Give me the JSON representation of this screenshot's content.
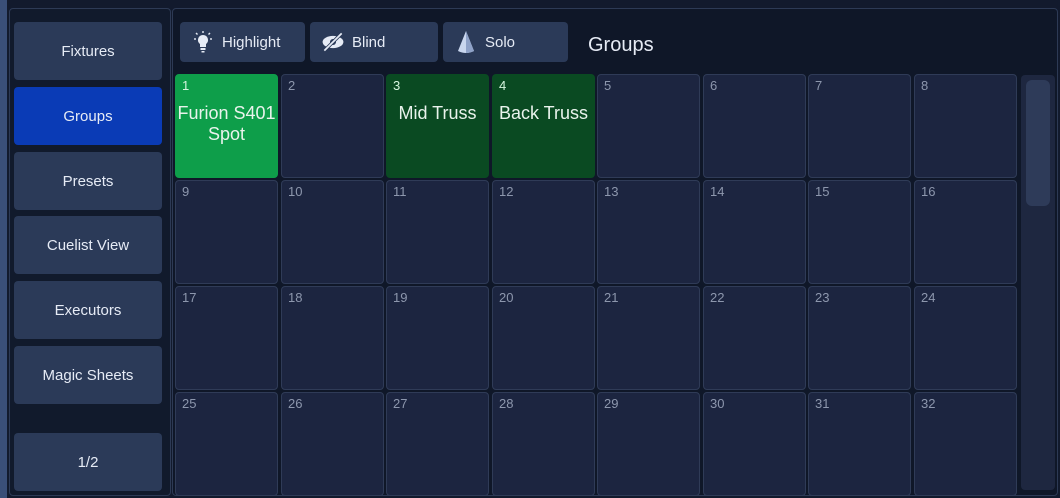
{
  "sidebar": {
    "items": [
      {
        "label": "Fixtures",
        "active": false
      },
      {
        "label": "Groups",
        "active": true
      },
      {
        "label": "Presets",
        "active": false
      },
      {
        "label": "Cuelist View",
        "active": false
      },
      {
        "label": "Executors",
        "active": false
      },
      {
        "label": "Magic Sheets",
        "active": false
      }
    ],
    "page_label": "1/2"
  },
  "toolbar": {
    "highlight_label": "Highlight",
    "blind_label": "Blind",
    "solo_label": "Solo",
    "view_title": "Groups"
  },
  "groups": [
    {
      "num": "1",
      "name": "Furion S401 Spot",
      "state": "selected"
    },
    {
      "num": "2",
      "name": "",
      "state": "empty"
    },
    {
      "num": "3",
      "name": "Mid Truss",
      "state": "recorded"
    },
    {
      "num": "4",
      "name": "Back Truss",
      "state": "recorded"
    },
    {
      "num": "5",
      "name": "",
      "state": "empty"
    },
    {
      "num": "6",
      "name": "",
      "state": "empty"
    },
    {
      "num": "7",
      "name": "",
      "state": "empty"
    },
    {
      "num": "8",
      "name": "",
      "state": "empty"
    },
    {
      "num": "9",
      "name": "",
      "state": "empty"
    },
    {
      "num": "10",
      "name": "",
      "state": "empty"
    },
    {
      "num": "11",
      "name": "",
      "state": "empty"
    },
    {
      "num": "12",
      "name": "",
      "state": "empty"
    },
    {
      "num": "13",
      "name": "",
      "state": "empty"
    },
    {
      "num": "14",
      "name": "",
      "state": "empty"
    },
    {
      "num": "15",
      "name": "",
      "state": "empty"
    },
    {
      "num": "16",
      "name": "",
      "state": "empty"
    },
    {
      "num": "17",
      "name": "",
      "state": "empty"
    },
    {
      "num": "18",
      "name": "",
      "state": "empty"
    },
    {
      "num": "19",
      "name": "",
      "state": "empty"
    },
    {
      "num": "20",
      "name": "",
      "state": "empty"
    },
    {
      "num": "21",
      "name": "",
      "state": "empty"
    },
    {
      "num": "22",
      "name": "",
      "state": "empty"
    },
    {
      "num": "23",
      "name": "",
      "state": "empty"
    },
    {
      "num": "24",
      "name": "",
      "state": "empty"
    },
    {
      "num": "25",
      "name": "",
      "state": "empty"
    },
    {
      "num": "26",
      "name": "",
      "state": "empty"
    },
    {
      "num": "27",
      "name": "",
      "state": "empty"
    },
    {
      "num": "28",
      "name": "",
      "state": "empty"
    },
    {
      "num": "29",
      "name": "",
      "state": "empty"
    },
    {
      "num": "30",
      "name": "",
      "state": "empty"
    },
    {
      "num": "31",
      "name": "",
      "state": "empty"
    },
    {
      "num": "32",
      "name": "",
      "state": "empty"
    }
  ],
  "colors": {
    "active_blue": "#0a3bb6",
    "selected_green": "#0e9e4a",
    "recorded_green": "#0a4a22"
  },
  "icons": {
    "highlight": "lightbulb-icon",
    "blind": "eye-slash-icon",
    "solo": "spotlight-icon"
  }
}
